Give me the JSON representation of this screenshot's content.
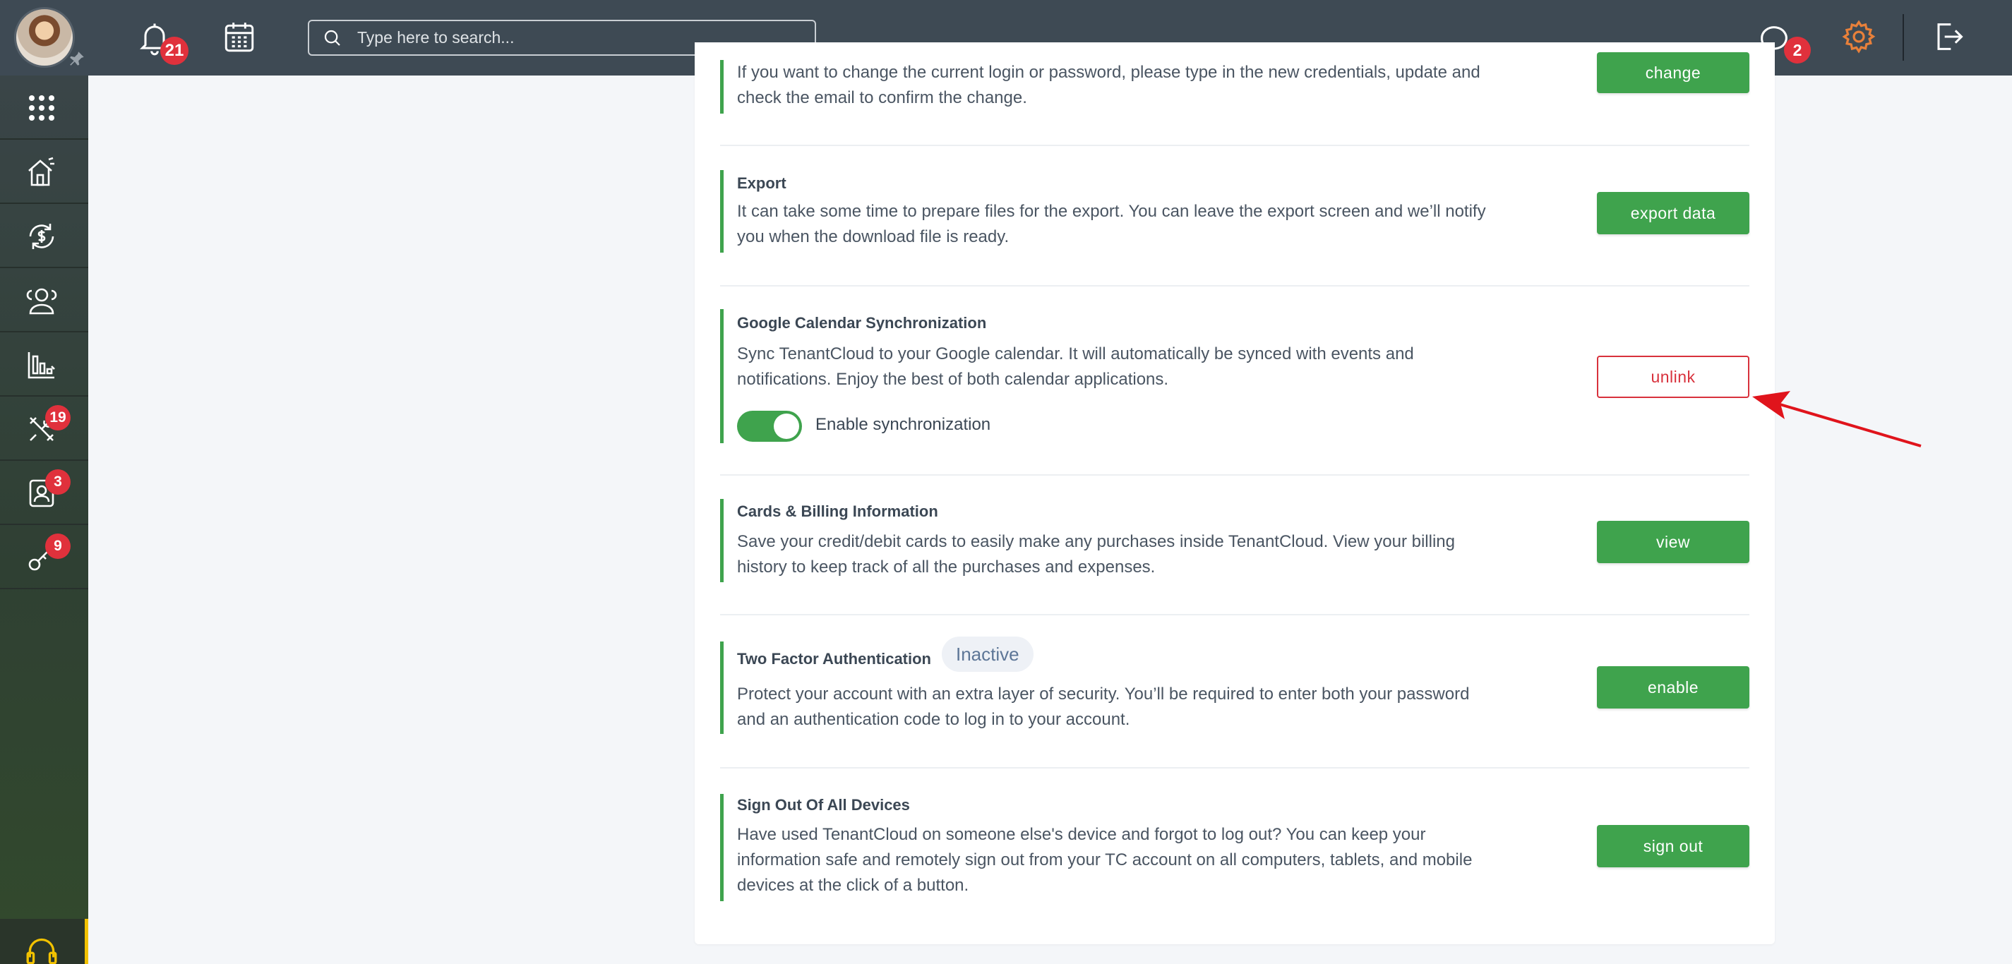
{
  "topbar": {
    "notifications_count": "21",
    "search_placeholder": "Type here to search...",
    "messages_count": "2"
  },
  "sidebar": {
    "items": [
      {
        "icon": "apps-grid-icon",
        "badge": ""
      },
      {
        "icon": "properties-house-icon",
        "badge": ""
      },
      {
        "icon": "accounting-dollar-icon",
        "badge": ""
      },
      {
        "icon": "people-icon",
        "badge": ""
      },
      {
        "icon": "reports-chart-icon",
        "badge": ""
      },
      {
        "icon": "maintenance-tools-icon",
        "badge": "19"
      },
      {
        "icon": "applications-contact-icon",
        "badge": "3"
      },
      {
        "icon": "marketing-key-icon",
        "badge": "9"
      }
    ],
    "support_icon": "headset-icon"
  },
  "sections": {
    "login": {
      "desc": "If you want to change the current login or password, please type in the new credentials, update and check the email to confirm the change.",
      "button": "change"
    },
    "export": {
      "title": "Export",
      "desc": "It can take some time to prepare files for the export. You can leave the export screen and we’ll notify you when the download file is ready.",
      "button": "export data"
    },
    "google_calendar": {
      "title": "Google Calendar Synchronization",
      "desc": "Sync TenantCloud to your Google calendar. It will automatically be synced with events and notifications. Enjoy the best of both calendar applications.",
      "toggle_label": "Enable synchronization",
      "toggle_on": true,
      "button": "unlink"
    },
    "billing": {
      "title": "Cards & Billing Information",
      "desc": "Save your credit/debit cards to easily make any purchases inside TenantCloud. View your billing history to keep track of all the purchases and expenses.",
      "button": "view"
    },
    "two_factor": {
      "title": "Two Factor Authentication",
      "status": "Inactive",
      "desc": "Protect your account with an extra layer of security. You’ll be required to enter both your password and an authentication code to log in to your account.",
      "button": "enable"
    },
    "sign_out": {
      "title": "Sign Out Of All Devices",
      "desc": "Have used TenantCloud on someone else's device and forgot to log out? You can keep your information safe and remotely sign out from your TC account on all computers, tablets, and mobile devices at the click of a button.",
      "button": "sign out"
    }
  },
  "colors": {
    "accent_green": "#3fa34d",
    "danger_red": "#d8313c",
    "topbar": "#3e4a54"
  }
}
